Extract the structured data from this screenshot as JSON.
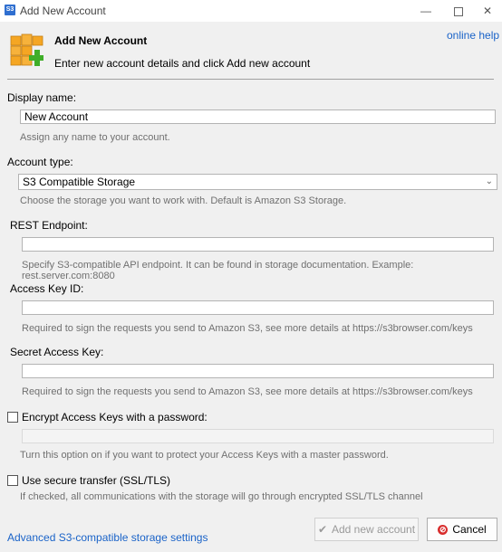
{
  "window": {
    "title": "Add New Account",
    "app_icon_text": "S3",
    "minimize_glyph": "—",
    "close_glyph": "✕"
  },
  "header": {
    "title": "Add New Account",
    "subtitle": "Enter new account details and click Add new account",
    "help_link": "online help",
    "icon": "boxes-add-icon"
  },
  "display_name": {
    "label": "Display name:",
    "value": "New Account",
    "hint": "Assign any name to your account."
  },
  "account_type": {
    "label": "Account type:",
    "selected": "S3 Compatible Storage",
    "hint": "Choose the storage you want to work with. Default is Amazon S3 Storage."
  },
  "rest_endpoint": {
    "label": "REST Endpoint:",
    "value": "",
    "hint": "Specify S3-compatible API endpoint. It can be found in storage documentation. Example: rest.server.com:8080"
  },
  "access_key": {
    "label": "Access Key ID:",
    "value": "",
    "hint": "Required to sign the requests you send to Amazon S3, see more details at https://s3browser.com/keys"
  },
  "secret_key": {
    "label": "Secret Access Key:",
    "value": "",
    "hint": "Required to sign the requests you send to Amazon S3, see more details at https://s3browser.com/keys"
  },
  "encrypt": {
    "label": "Encrypt Access Keys with a password:",
    "checked": false,
    "value": "",
    "hint": "Turn this option on if you want to protect your Access Keys with a master password."
  },
  "secure": {
    "label": "Use secure transfer (SSL/TLS)",
    "checked": false,
    "hint": "If checked, all communications with the storage will go through encrypted SSL/TLS channel"
  },
  "footer": {
    "advanced_link": "Advanced S3-compatible storage settings",
    "add_button": "Add new account",
    "cancel_button": "Cancel",
    "cancel_icon_glyph": "⊘",
    "add_icon_glyph": "✔"
  },
  "colors": {
    "link": "#1a63c8",
    "hint": "#707070",
    "background": "#f0f0f0",
    "box_orange": "#f5a623",
    "plus_green": "#3fae29"
  }
}
